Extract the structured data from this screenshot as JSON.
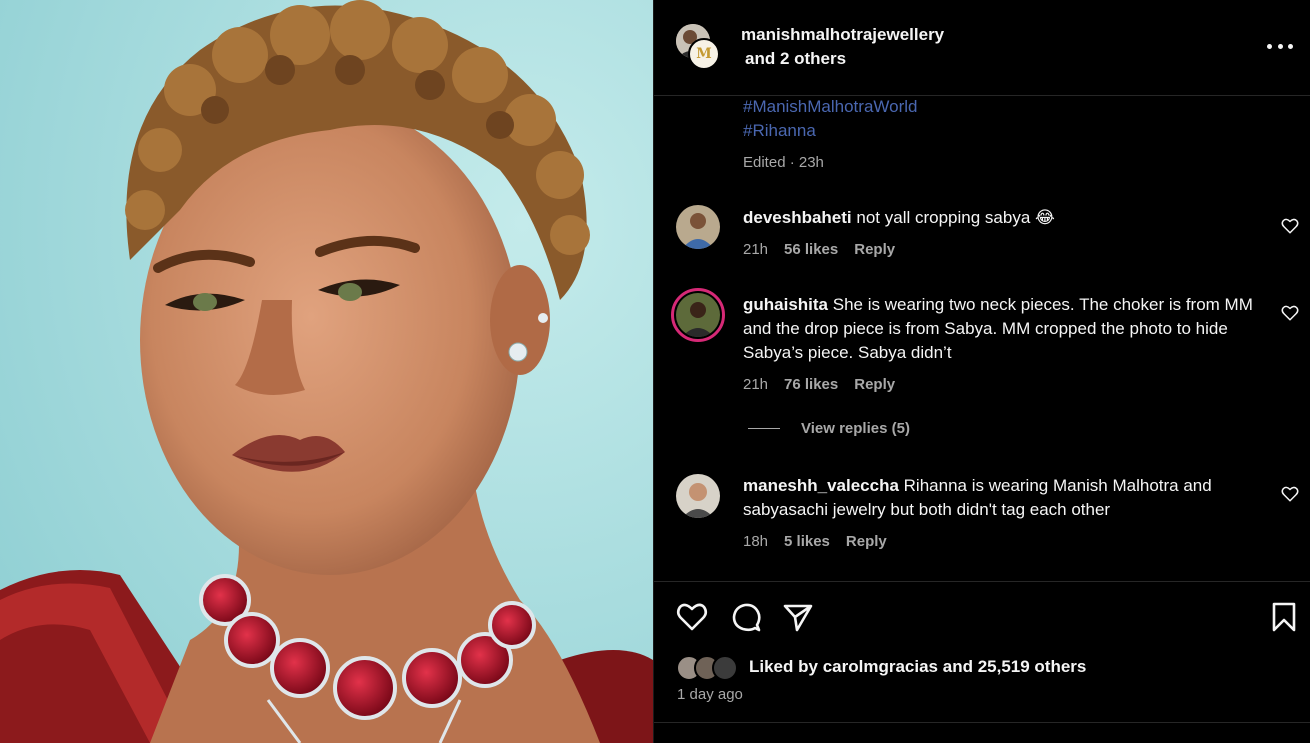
{
  "post": {
    "author": "manishmalhotrajewellery",
    "coauthors": "and 2 others",
    "logo_letter": "M",
    "hashtags": [
      "#ManishMalhotraWorld",
      "#Rihanna"
    ],
    "edited": "Edited · 23h",
    "icons": {
      "more": "more-options-icon",
      "like": "heart-icon",
      "comment": "comment-bubble-icon",
      "share": "paper-plane-icon",
      "save": "bookmark-icon"
    }
  },
  "comments": [
    {
      "username": "deveshbaheti",
      "text": "not yall cropping sabya 😂",
      "time": "21h",
      "likes": "56 likes",
      "reply": "Reply"
    },
    {
      "username": "guhaishita",
      "text": "She is wearing two neck pieces. The choker is from MM and the drop piece is from Sabya. MM cropped the photo to hide Sabya’s piece. Sabya didn’t",
      "time": "21h",
      "likes": "76 likes",
      "reply": "Reply",
      "view_replies": "View replies (5)"
    },
    {
      "username": "maneshh_valeccha",
      "text": "Rihanna is wearing Manish Malhotra and sabyasachi jewelry but both didn't tag each other",
      "time": "18h",
      "likes": "5 likes",
      "reply": "Reply"
    }
  ],
  "likes_summary": {
    "prefix": "Liked by",
    "user": "carolmgracias",
    "joiner": "and",
    "others": "25,519 others"
  },
  "posted_ago": "1 day ago",
  "colors": {
    "background": "#000000",
    "hashtag": "#4a67b0",
    "secondary_text": "#a8a8a8",
    "story_ring": "#d62976",
    "photo_backdrop": "#a9dcdf",
    "ruby": "#b0102a"
  }
}
